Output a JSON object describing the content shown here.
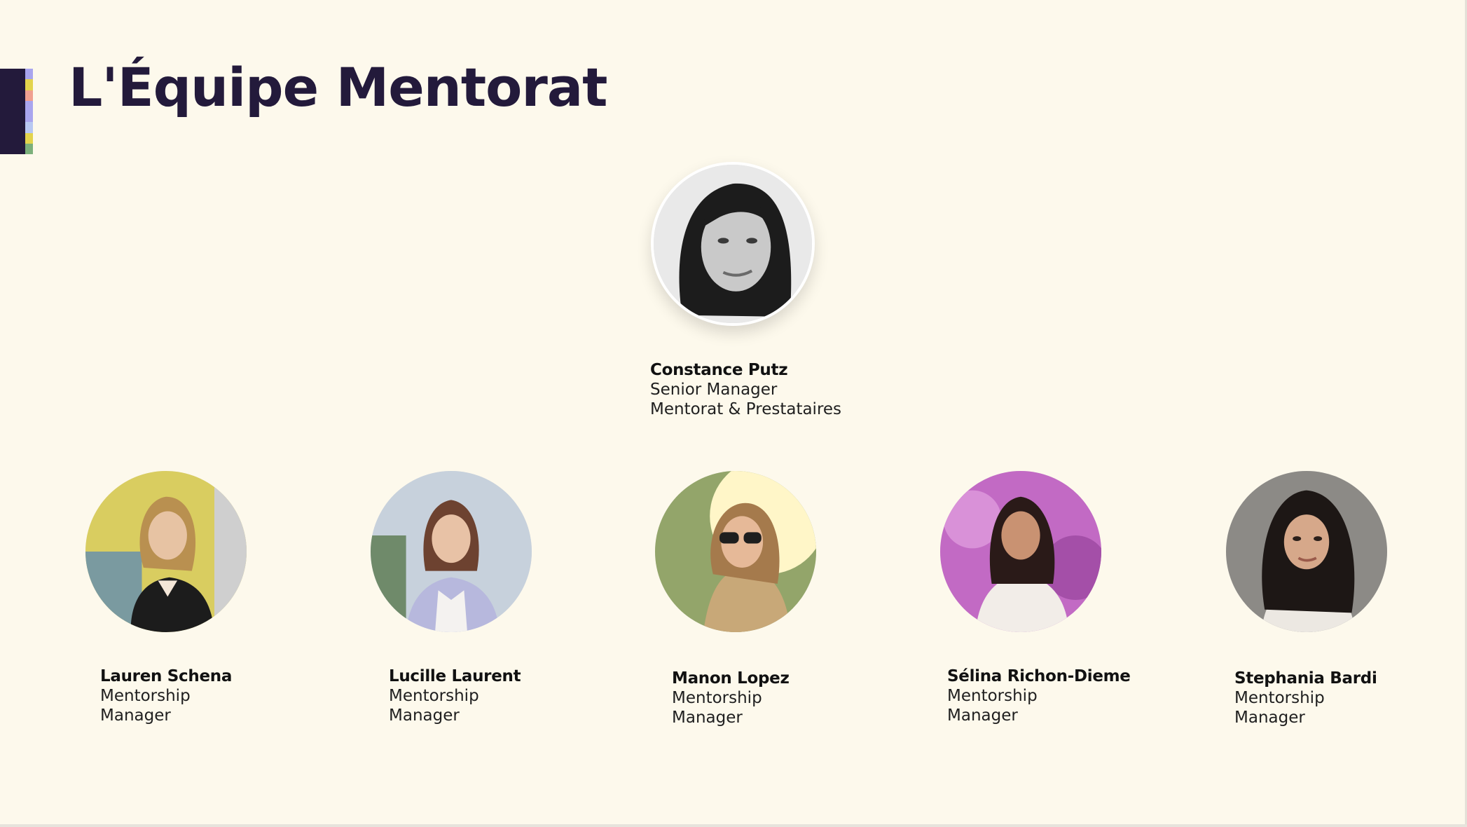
{
  "title": "L'Équipe Mentorat",
  "accent_colors": [
    "#a9a5ee",
    "#e3d44c",
    "#f0a090",
    "#a9a5ee",
    "#b8c8f2",
    "#e3d44c",
    "#7cb07b"
  ],
  "lead": {
    "name": "Constance Putz",
    "role_line1": "Senior Manager",
    "role_line2": "Mentorat & Prestataires",
    "photo_icon": "portrait-photo-grayscale"
  },
  "team": [
    {
      "name": "Lauren Schena",
      "role_line1": "Mentorship",
      "role_line2": "Manager",
      "photo_icon": "portrait-photo"
    },
    {
      "name": "Lucille Laurent",
      "role_line1": "Mentorship",
      "role_line2": "Manager",
      "photo_icon": "portrait-photo"
    },
    {
      "name": "Manon Lopez",
      "role_line1": "Mentorship",
      "role_line2": "Manager",
      "photo_icon": "portrait-photo"
    },
    {
      "name": "Sélina Richon-Dieme",
      "role_line1": "Mentorship",
      "role_line2": "Manager",
      "photo_icon": "portrait-photo"
    },
    {
      "name": "Stephania Bardi",
      "role_line1": "Mentorship",
      "role_line2": "Manager",
      "photo_icon": "portrait-photo"
    }
  ]
}
